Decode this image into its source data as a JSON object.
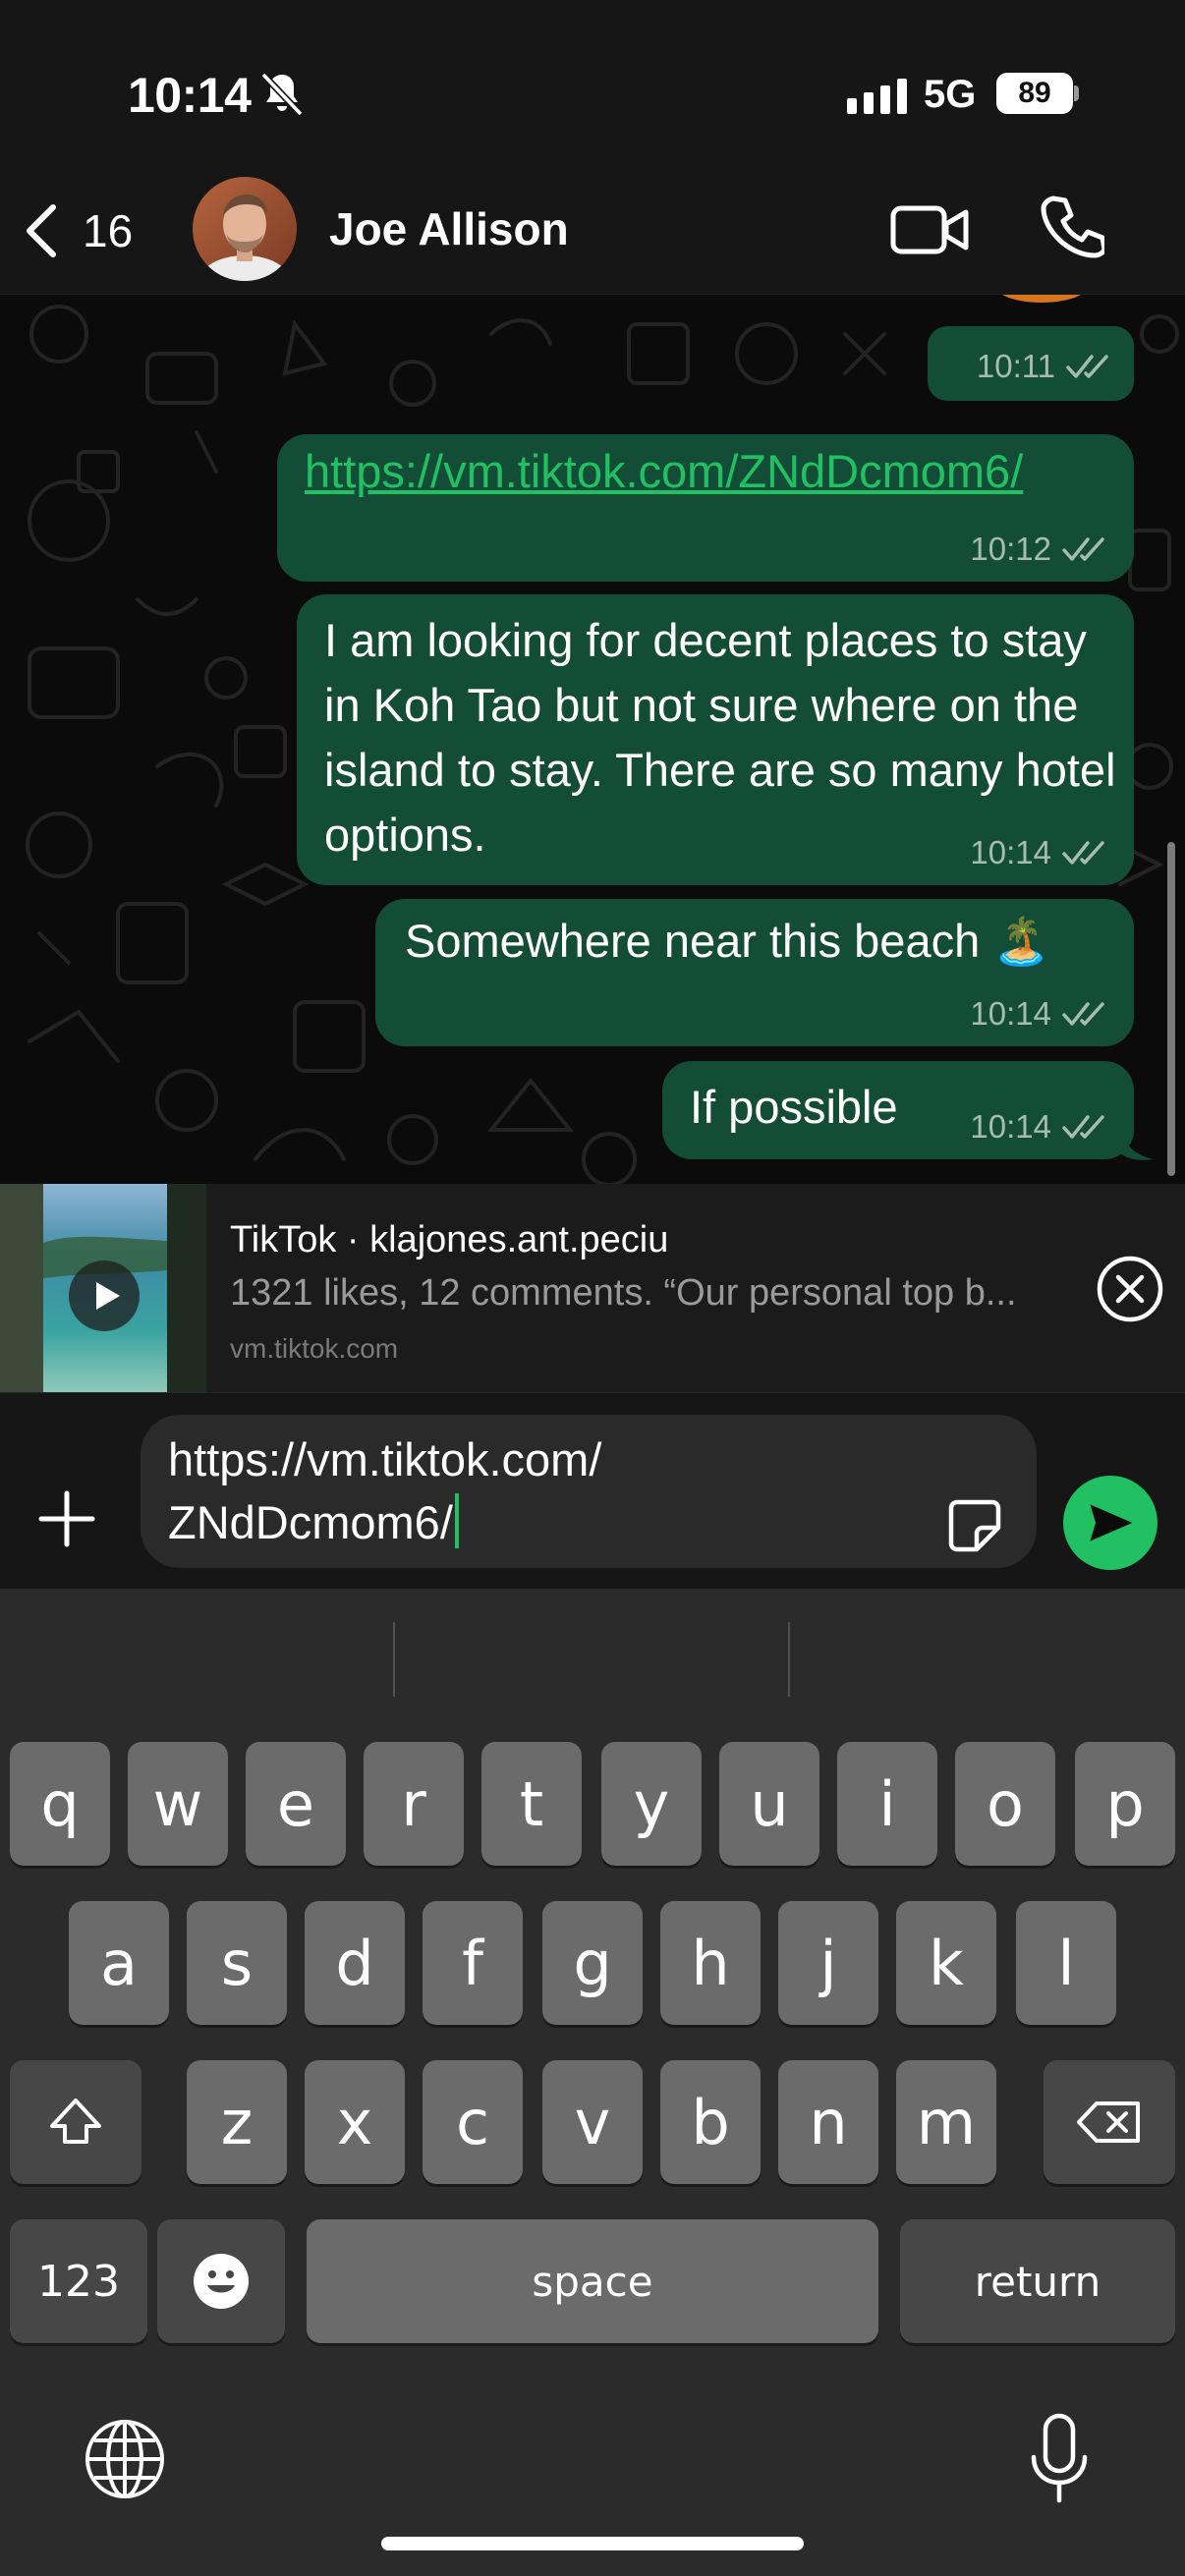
{
  "status_bar": {
    "time": "10:14",
    "network": "5G",
    "battery": "89",
    "silent_icon": "bell-slash-icon",
    "signal_icon": "cellular-signal-icon"
  },
  "header": {
    "back_count": "16",
    "contact_name": "Joe Allison",
    "video_icon": "video-camera-icon",
    "call_icon": "phone-icon"
  },
  "messages": [
    {
      "text": "",
      "time": "10:11",
      "status": "read"
    },
    {
      "text": "https://vm.tiktok.com/ZNdDcmom6/",
      "time": "10:12",
      "is_link": true,
      "status": "read"
    },
    {
      "text": "I am looking for decent places to stay in Koh Tao but not sure where on the island to stay. There are so many hotel options.",
      "time": "10:14",
      "status": "read"
    },
    {
      "text": "Somewhere near this beach 🏝️",
      "time": "10:14",
      "status": "read"
    },
    {
      "text": "If possible",
      "time": "10:14",
      "status": "read"
    }
  ],
  "link_preview": {
    "title": "TikTok · klajones.ant.peciu",
    "description": "1321 likes, 12 comments. “Our personal top b...",
    "domain": "vm.tiktok.com"
  },
  "composer": {
    "value": "https://vm.tiktok.com/ZNdDcmom6/",
    "line1": "https://vm.tiktok.com/",
    "line2": "ZNdDcmom6/"
  },
  "keyboard": {
    "row1": [
      "q",
      "w",
      "e",
      "r",
      "t",
      "y",
      "u",
      "i",
      "o",
      "p"
    ],
    "row2": [
      "a",
      "s",
      "d",
      "f",
      "g",
      "h",
      "j",
      "k",
      "l"
    ],
    "row3": [
      "z",
      "x",
      "c",
      "v",
      "b",
      "n",
      "m"
    ],
    "numbers_key": "123",
    "space_key": "space",
    "return_key": "return"
  },
  "colors": {
    "bubble_out": "#144d37",
    "accent": "#21c063",
    "background": "#0b0b0b"
  }
}
